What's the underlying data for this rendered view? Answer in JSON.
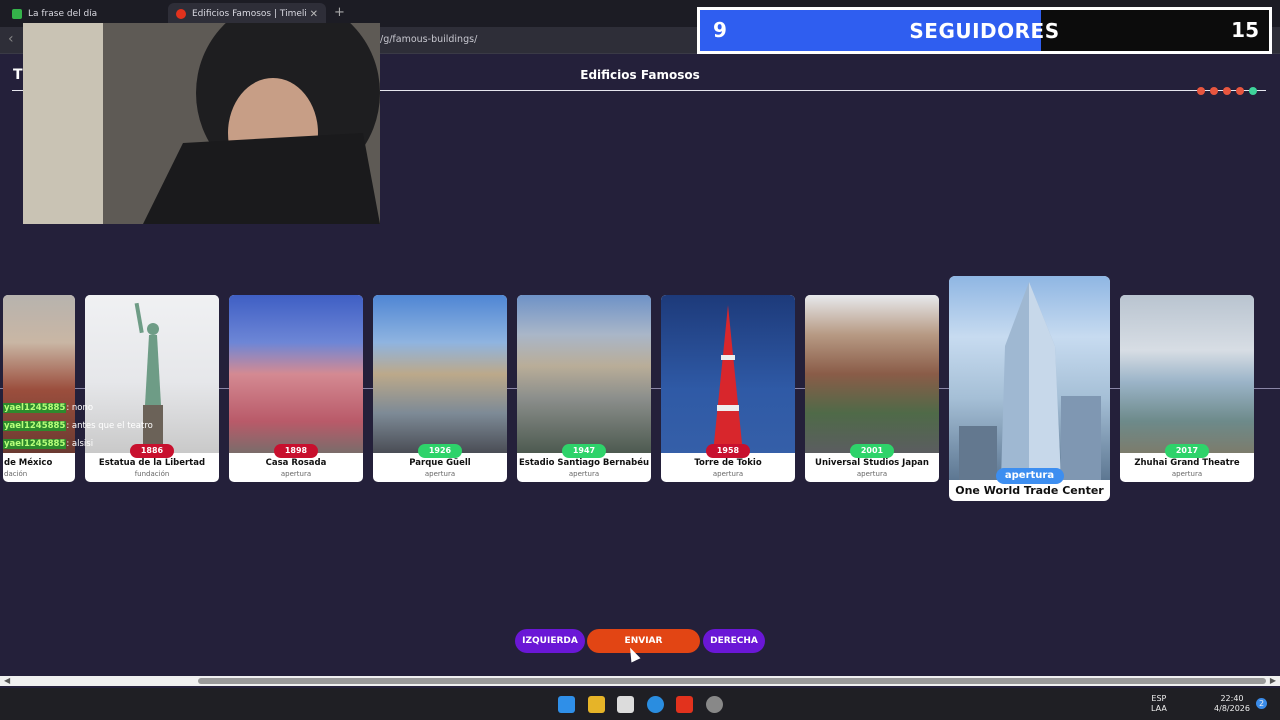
{
  "browser": {
    "tabs": [
      {
        "title": "La frase del día"
      },
      {
        "title": "Edificios Famosos | Timeline.Gam"
      }
    ],
    "url": "/g/famous-buildings/"
  },
  "page": {
    "title_left": "T",
    "title": "Edificios Famosos",
    "progress_dots": [
      {
        "color": "#e8563f"
      },
      {
        "color": "#e8563f"
      },
      {
        "color": "#e8563f"
      },
      {
        "color": "#e8563f"
      },
      {
        "color": "#3ed39a"
      }
    ]
  },
  "cards": [
    {
      "year": "",
      "name": "de México",
      "type": "dación",
      "year_color": "#c8102e"
    },
    {
      "year": "1886",
      "name": "Estatua de la Libertad",
      "type": "fundación",
      "year_color": "#c8102e"
    },
    {
      "year": "1898",
      "name": "Casa Rosada",
      "type": "apertura",
      "year_color": "#c8102e"
    },
    {
      "year": "1926",
      "name": "Parque Güell",
      "type": "apertura",
      "year_color": "#2ed36a"
    },
    {
      "year": "1947",
      "name": "Estadio Santiago Bernabéu",
      "type": "apertura",
      "year_color": "#2ed36a"
    },
    {
      "year": "1958",
      "name": "Torre de Tokio",
      "type": "apertura",
      "year_color": "#c8102e"
    },
    {
      "year": "2001",
      "name": "Universal Studios Japan",
      "type": "apertura",
      "year_color": "#2ed36a"
    },
    {
      "year": "2017",
      "name": "Zhuhai Grand Theatre",
      "type": "apertura",
      "year_color": "#2ed36a"
    }
  ],
  "featured": {
    "type": "apertura",
    "name": "One World Trade Center"
  },
  "chat": [
    {
      "user": "yael1245885",
      "message": ": nono"
    },
    {
      "user": "yael1245885",
      "message": ": antes que el teatro"
    },
    {
      "user": "yael1245885",
      "message": ": alsisi"
    }
  ],
  "controls": {
    "left": "IZQUIERDA",
    "send": "ENVIAR",
    "right": "DERECHA"
  },
  "followers": {
    "current": "9",
    "label": "SEGUIDORES",
    "goal": "15",
    "progress": 0.6
  },
  "taskbar": {
    "lang": "ESP",
    "layout": "LAA",
    "time": "22:40",
    "date": "4/8/2026",
    "notifications": "2"
  }
}
